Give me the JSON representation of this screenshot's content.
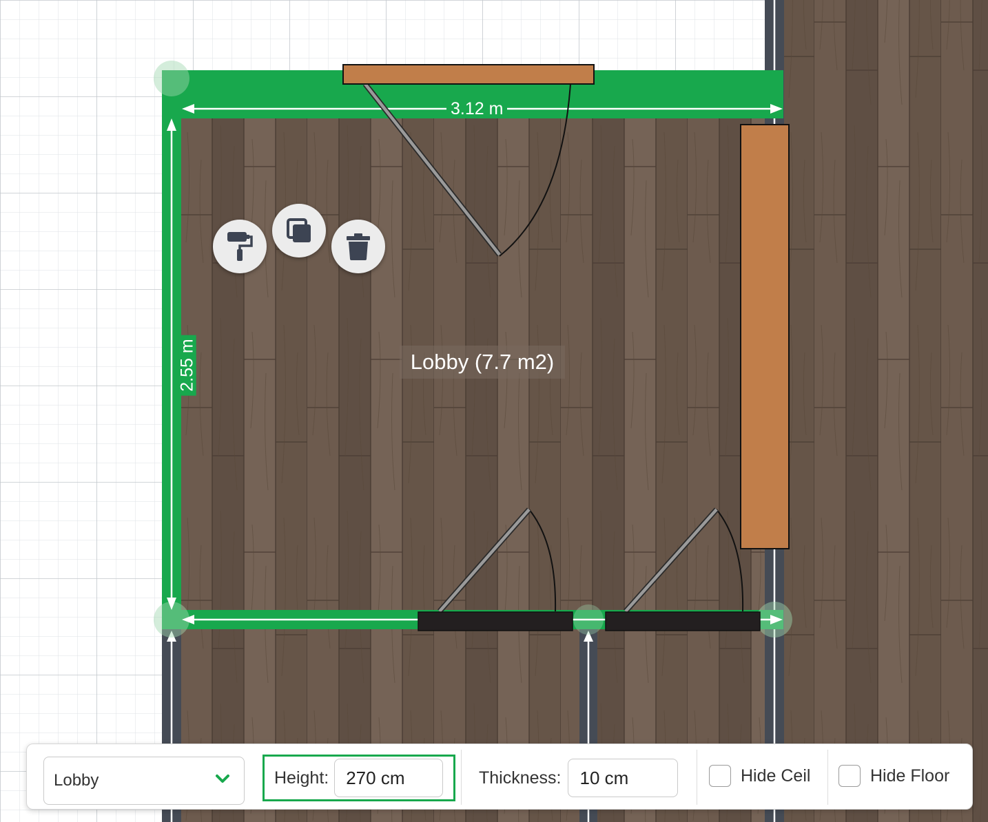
{
  "room": {
    "name_label": "Lobby (7.7 m2)",
    "width_label": "3.12 m",
    "height_label": "2.55 m"
  },
  "icons": {
    "paint": "paint-roller-icon",
    "duplicate": "duplicate-icon",
    "delete": "trash-icon"
  },
  "toolbar": {
    "room_select": {
      "value": "Lobby",
      "icon": "chevron-down-icon"
    },
    "height": {
      "label": "Height:",
      "value": "270 cm"
    },
    "thickness": {
      "label": "Thickness:",
      "value": "10 cm"
    },
    "hide_ceil": {
      "label": "Hide Ceil",
      "checked": false
    },
    "hide_floor": {
      "label": "Hide Floor",
      "checked": false
    }
  },
  "colors": {
    "wall_selected": "#18a84d",
    "grid_line": "#d0d4d8",
    "wall_dark": "#454b55",
    "door_frame": "#231f20",
    "furniture": "#c17e4a",
    "floor": "#6b5a4d"
  }
}
